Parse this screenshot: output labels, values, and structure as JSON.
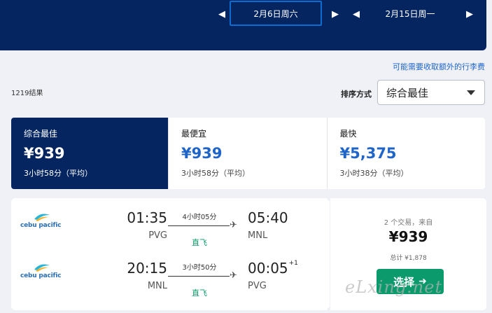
{
  "date_bar": {
    "departure_date": "2月6日周六",
    "return_date": "2月15日周一",
    "prev_icon": "triangle-left",
    "next_icon": "triangle-right"
  },
  "baggage_link": "可能需要收取额外的行李费",
  "result_count": "1219结果",
  "sort": {
    "label": "排序方式",
    "selected": "综合最佳"
  },
  "tabs": [
    {
      "title": "综合最佳",
      "price": "¥939",
      "duration": "3小时58分（平均）"
    },
    {
      "title": "最便宜",
      "price": "¥939",
      "duration": "3小时58分（平均）"
    },
    {
      "title": "最快",
      "price": "¥5,375",
      "duration": "3小时38分（平均）"
    }
  ],
  "result": {
    "legs": [
      {
        "airline": "cebu pacific",
        "dep_time": "01:35",
        "dep_airport": "PVG",
        "duration": "4小时05分",
        "stops": "直飞",
        "arr_time": "05:40",
        "arr_airport": "MNL",
        "plus_day": ""
      },
      {
        "airline": "cebu pacific",
        "dep_time": "20:15",
        "dep_airport": "MNL",
        "duration": "3小时50分",
        "stops": "直飞",
        "arr_time": "00:05",
        "arr_airport": "PVG",
        "plus_day": "+1"
      }
    ],
    "deals": "2 个交易，来自",
    "price": "¥939",
    "total": "总计 ¥1,878",
    "select_label": "选择"
  },
  "watermark": "eLxing.net",
  "colors": {
    "header_bg": "#052560",
    "accent_blue": "#1f65c9",
    "green": "#0b9a6b",
    "page_bg": "#eff1f6"
  }
}
